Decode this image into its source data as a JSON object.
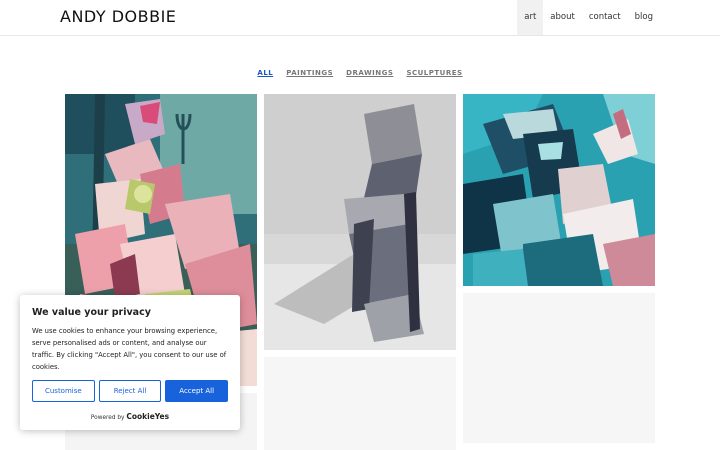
{
  "header": {
    "brand": "ANDY DOBBIE",
    "nav": [
      {
        "label": "art",
        "active": true
      },
      {
        "label": "about",
        "active": false
      },
      {
        "label": "contact",
        "active": false
      },
      {
        "label": "blog",
        "active": false
      }
    ]
  },
  "filters": [
    {
      "label": "ALL",
      "active": true
    },
    {
      "label": "PAINTINGS",
      "active": false
    },
    {
      "label": "DRAWINGS",
      "active": false
    },
    {
      "label": "SCULPTURES",
      "active": false
    }
  ],
  "colors": {
    "accent": "#1863dc",
    "active_filter": "#1a56c9"
  },
  "cookie": {
    "title": "We value your privacy",
    "text": "We use cookies to enhance your browsing experience, serve personalised ads or content, and analyse our traffic. By clicking \"Accept All\", you consent to our use of cookies.",
    "customise_label": "Customise",
    "reject_label": "Reject All",
    "accept_label": "Accept All",
    "powered_prefix": "Powered by",
    "powered_brand": "CookieYes"
  }
}
